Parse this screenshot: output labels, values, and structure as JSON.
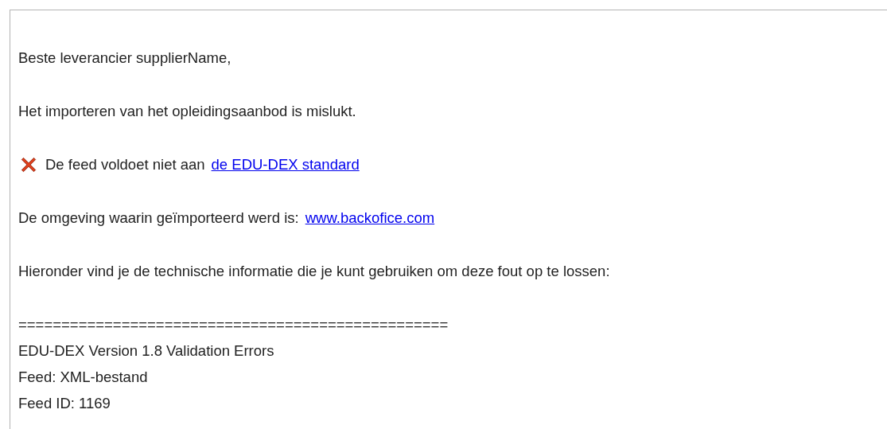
{
  "paragraphs": [
    {
      "kind": "text",
      "text": "Beste leverancier supplierName,"
    },
    {
      "kind": "text",
      "text": "Het importeren van het opleidingsaanbod is mislukt."
    },
    {
      "kind": "error",
      "text": "De feed voldoet niet aan",
      "link": "de EDU-DEX standard"
    },
    {
      "kind": "link",
      "text": "De omgeving waarin geïmporteerd werd is:",
      "link": "www.backofice.com"
    },
    {
      "kind": "text",
      "text": "Hieronder vind je de technische informatie die je kunt gebruiken om deze fout op te lossen:"
    },
    {
      "kind": "block",
      "lines": [
        "==================================================",
        "EDU-DEX Version 1.8 Validation Errors",
        "Feed: XML-bestand",
        "Feed ID: 1169"
      ]
    }
  ]
}
